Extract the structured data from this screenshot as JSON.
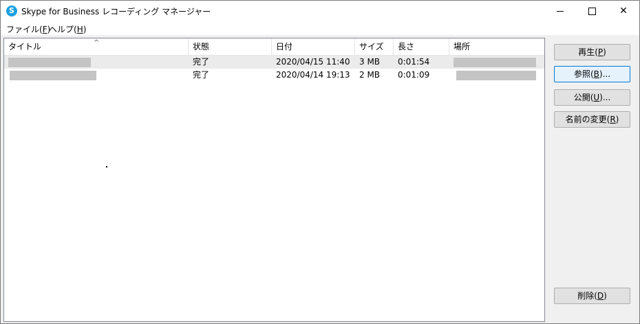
{
  "window": {
    "title": "Skype for Business レコーディング マネージャー",
    "controls": {
      "minimize": "minimize-icon",
      "maximize": "maximize-icon",
      "close": "close-icon"
    }
  },
  "menu": [
    {
      "label": "ファイル(",
      "key": "F",
      "suffix": ")"
    },
    {
      "label": "ヘルプ(",
      "key": "H",
      "suffix": ")"
    }
  ],
  "list": {
    "columns": [
      "タイトル",
      "状態",
      "日付",
      "サイズ",
      "長さ",
      "場所"
    ],
    "sort_indicator": "^",
    "rows": [
      {
        "title": "",
        "status": "完了",
        "date": "2020/04/15 11:40",
        "size": "3 MB",
        "length": "0:01:54",
        "location": ""
      },
      {
        "title": "",
        "status": "完了",
        "date": "2020/04/14 19:13",
        "size": "2 MB",
        "length": "0:01:09",
        "location": ""
      }
    ]
  },
  "buttons": {
    "play": {
      "label": "再生(",
      "key": "P",
      "suffix": ")"
    },
    "browse": {
      "label": "参照(",
      "key": "B",
      "suffix": ")..."
    },
    "publish": {
      "label": "公開(",
      "key": "U",
      "suffix": ")..."
    },
    "rename": {
      "label": "名前の変更(",
      "key": "R",
      "suffix": ")"
    },
    "delete": {
      "label": "削除(",
      "key": "D",
      "suffix": ")"
    }
  },
  "colors": {
    "selection": "#ebebeb",
    "focus_border": "#0078d7",
    "app_icon": "#1ba1e2"
  }
}
